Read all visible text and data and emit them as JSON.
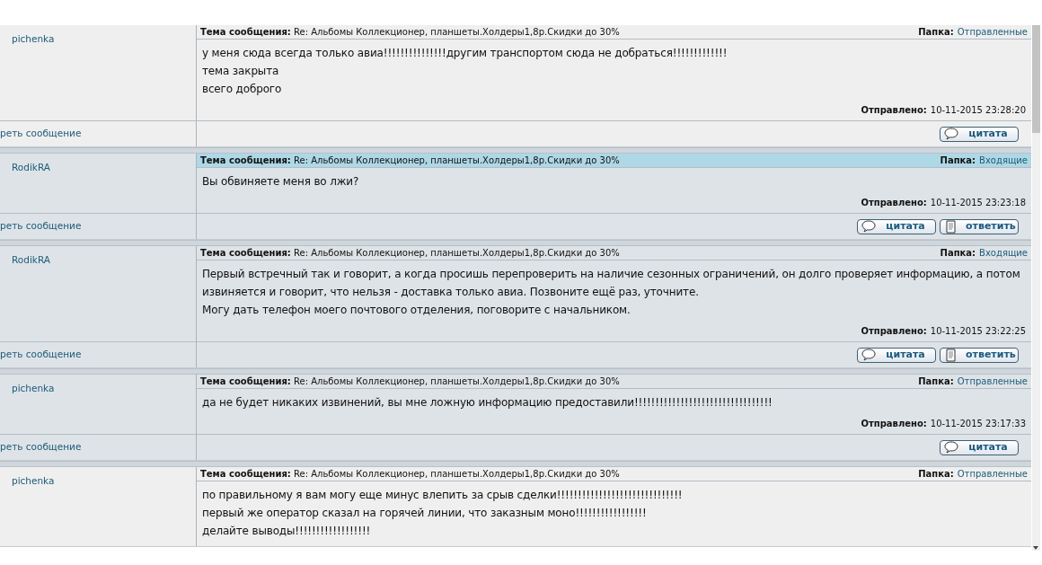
{
  "messages": [
    {
      "author": "pichenka",
      "color": "#efefef",
      "highlighted": false,
      "subject_label": "Тема сообщения:",
      "subject": "Re: Альбомы Коллекционер, планшеты.Холдеры1,8р.Скидки до 30%",
      "folder_label": "Папка:",
      "folder": "Отправленные",
      "lines": [
        "у меня сюда всегда только авиа!!!!!!!!!!!!!!!другим транспортом сюда не добраться!!!!!!!!!!!!!",
        "тема закрыта",
        "всего доброго"
      ],
      "sent_label": "Отправлено:",
      "sent": "10-11-2015 23:28:20",
      "view_link": "реть сообщение",
      "buttons": [
        {
          "kind": "quote",
          "label": "цитата"
        }
      ]
    },
    {
      "author": "RodikRA",
      "color": "#dee3e7",
      "highlighted": true,
      "subject_label": "Тема сообщения:",
      "subject": "Re: Альбомы Коллекционер, планшеты.Холдеры1,8р.Скидки до 30%",
      "folder_label": "Папка:",
      "folder": "Входящие",
      "lines": [
        "Вы обвиняете меня во лжи?"
      ],
      "sent_label": "Отправлено:",
      "sent": "10-11-2015 23:23:18",
      "view_link": "реть сообщение",
      "buttons": [
        {
          "kind": "quote",
          "label": "цитата"
        },
        {
          "kind": "reply",
          "label": "ответить"
        }
      ]
    },
    {
      "author": "RodikRA",
      "color": "#dee3e7",
      "highlighted": false,
      "subject_label": "Тема сообщения:",
      "subject": "Re: Альбомы Коллекционер, планшеты.Холдеры1,8р.Скидки до 30%",
      "folder_label": "Папка:",
      "folder": "Входящие",
      "lines": [
        "Первый встречный так и говорит, а когда просишь перепроверить на наличие сезонных ограничений, он долго проверяет информацию, а потом извиняется и говорит, что нельзя - доставка только авиа. Позвоните ещё раз, уточните.",
        "Могу дать телефон моего почтового отделения, поговорите с начальником."
      ],
      "sent_label": "Отправлено:",
      "sent": "10-11-2015 23:22:25",
      "view_link": "реть сообщение",
      "buttons": [
        {
          "kind": "quote",
          "label": "цитата"
        },
        {
          "kind": "reply",
          "label": "ответить"
        }
      ]
    },
    {
      "author": "pichenka",
      "color": "#dee3e7",
      "highlighted": false,
      "subject_label": "Тема сообщения:",
      "subject": "Re: Альбомы Коллекционер, планшеты.Холдеры1,8р.Скидки до 30%",
      "folder_label": "Папка:",
      "folder": "Отправленные",
      "lines": [
        "да не будет никаких извинений, вы мне ложную информацию предоставили!!!!!!!!!!!!!!!!!!!!!!!!!!!!!!!!!"
      ],
      "sent_label": "Отправлено:",
      "sent": "10-11-2015 23:17:33",
      "view_link": "реть сообщение",
      "buttons": [
        {
          "kind": "quote",
          "label": "цитата"
        }
      ]
    },
    {
      "author": "pichenka",
      "color": "#efefef",
      "highlighted": false,
      "subject_label": "Тема сообщения:",
      "subject": "Re: Альбомы Коллекционер, планшеты.Холдеры1,8р.Скидки до 30%",
      "folder_label": "Папка:",
      "folder": "Отправленные",
      "lines": [
        "по правильному я вам могу еще минус влепить за срыв сделки!!!!!!!!!!!!!!!!!!!!!!!!!!!!!!",
        "первый же оператор сказал на горячей линии, что заказным моно!!!!!!!!!!!!!!!!!",
        "делайте выводы!!!!!!!!!!!!!!!!!!"
      ]
    }
  ]
}
